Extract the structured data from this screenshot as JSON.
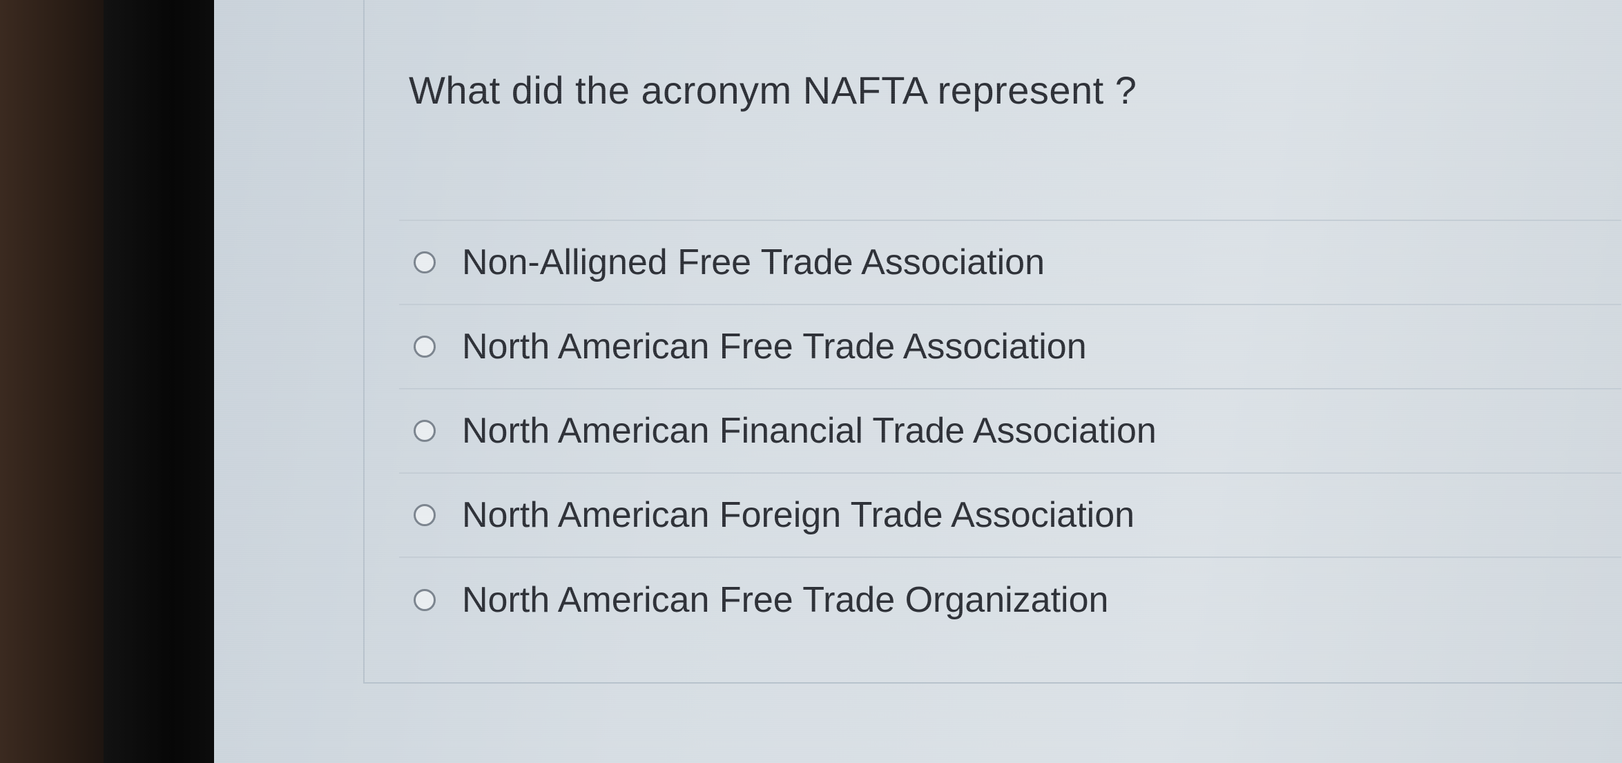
{
  "question": {
    "text": "What did the acronym NAFTA represent ?"
  },
  "answers": [
    {
      "label": "Non-Alligned Free Trade Association",
      "selected": false
    },
    {
      "label": "North American Free Trade Association",
      "selected": false
    },
    {
      "label": "North American Financial Trade Association",
      "selected": false
    },
    {
      "label": "North American Foreign Trade Association",
      "selected": false
    },
    {
      "label": "North American Free Trade Organization",
      "selected": false
    }
  ],
  "colors": {
    "text": "#2c2f36",
    "radio_border": "#7a838d",
    "divider": "#c3ccd4"
  }
}
